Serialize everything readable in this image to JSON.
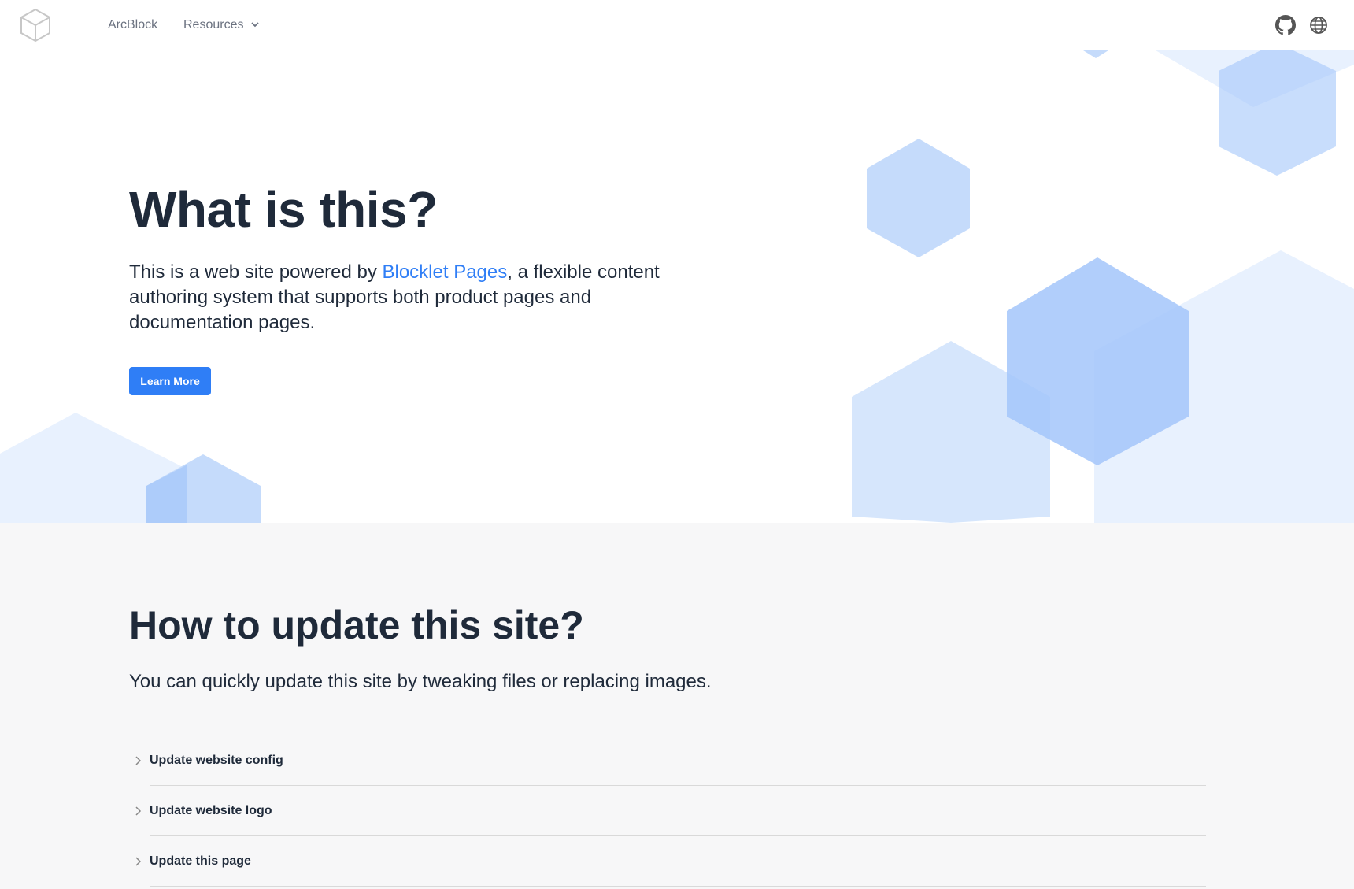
{
  "header": {
    "logo_icon": "cube-icon",
    "nav": [
      {
        "label": "ArcBlock"
      },
      {
        "label": "Resources",
        "icon": "chevron-down-icon"
      }
    ],
    "icons": [
      "github-icon",
      "globe-icon"
    ]
  },
  "hero": {
    "title": "What is this?",
    "desc_before": "This is a web site powered by ",
    "desc_link": "Blocklet Pages",
    "desc_after": ", a flexible content authoring system that supports both product pages and documentation pages.",
    "button_label": "Learn More"
  },
  "section2": {
    "title": "How to update this site?",
    "subtitle": "You can quickly update this site by tweaking files or replacing images.",
    "items": [
      {
        "label": "Update website config"
      },
      {
        "label": "Update website logo"
      },
      {
        "label": "Update this page"
      }
    ]
  },
  "colors": {
    "accent": "#2f7ef6",
    "text_dark": "#1f2a3a",
    "nav_text": "#6b7280",
    "section_bg": "#f7f7f8",
    "hex_light": "#e8f1fe",
    "hex_mid": "#c5dbfb",
    "hex_strong": "#a3c6fa"
  }
}
